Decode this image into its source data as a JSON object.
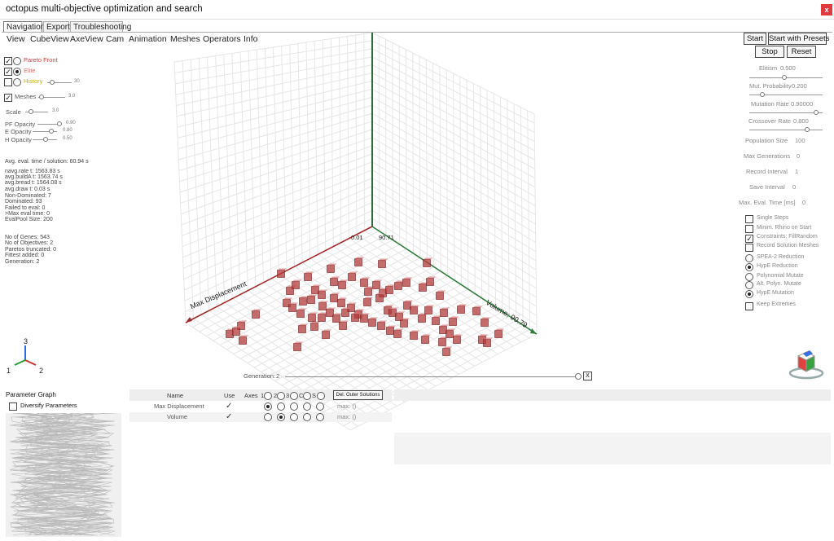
{
  "window": {
    "title": "octopus multi-objective optimization and search",
    "close_label": "x"
  },
  "tabs": [
    "Navigation",
    "Export",
    "Troubleshooting"
  ],
  "menu": [
    "View",
    "CubeView",
    "AxeView",
    "Cam",
    "Animation",
    "Meshes",
    "Operators",
    "Info"
  ],
  "left_panel": {
    "pareto_front": "Pareto Front",
    "elite": "Elite",
    "history": "History",
    "history_value": "30",
    "meshes": "Meshes",
    "meshes_value": "3.0",
    "scale": "Scale",
    "scale_value": "3.0",
    "pf_opacity": "PF Opacity",
    "pf_opacity_value": "0.90",
    "e_opacity": "E Opacity",
    "e_opacity_value": "0.80",
    "h_opacity": "H Opacity",
    "h_opacity_value": "0.50",
    "stats1": [
      "Avg. eval. time / solution: 60.94 s"
    ],
    "stats2": [
      "navg.rate t: 1563.83 s",
      "avg.buildA t: 1563.74 s",
      "avg.bread t: 1564.08 s",
      "avg.draw t: 0.03 s",
      "Non-Dominated: 7",
      "Dominated: 93",
      "Failed to eval: 0",
      ">Max eval time: 0",
      "EvalPool Size: 200"
    ],
    "stats3": [
      "No of Genes: 543",
      "No of Objectives: 2",
      "Paretos truncated: 0",
      "Fittest added: 0",
      "Generation: 2"
    ],
    "axis_labels": [
      "3",
      "1",
      "2"
    ]
  },
  "viewport": {
    "axis_x_label": "Max Displacement",
    "axis_y_label": "Volume: 90.79",
    "tick_a": "0.01",
    "tick_b": "90.71",
    "generation_label": "Generation:",
    "generation_value": "2",
    "generation_close": "X",
    "axis_colors": {
      "x": "#a42b2b",
      "y": "#2f7d3a",
      "z": "#2f6b3a"
    },
    "cube_color": "#b23b3b"
  },
  "right_panel": {
    "start": "Start",
    "start_presets": "Start with Presets",
    "stop": "Stop",
    "reset": "Reset",
    "elitism": "Elitism",
    "elitism_value": "0.500",
    "mut_prob": "Mut. Probability",
    "mut_prob_value": "0.200",
    "mut_rate": "Mutation Rate",
    "mut_rate_value": "0.90000",
    "cross_rate": "Crossover Rate",
    "cross_rate_value": "0.800",
    "pop_size": "Population Size",
    "pop_size_value": "100",
    "max_gen": "Max Generations",
    "max_gen_value": "0",
    "record_int": "Record Interval",
    "record_int_value": "1",
    "save_int": "Save Interval",
    "save_int_value": "0",
    "max_eval": "Max. Eval. Time [ms]",
    "max_eval_value": "0",
    "options": [
      {
        "label": "Single Steps",
        "kind": "check",
        "on": false
      },
      {
        "label": "Minim. Rhino on Start",
        "kind": "check",
        "on": false
      },
      {
        "label": "Constraints: FillRandom",
        "kind": "check",
        "on": true
      },
      {
        "label": "Record Solution Meshes",
        "kind": "check",
        "on": false
      },
      {
        "label": "SPEA-2 Reduction",
        "kind": "radio",
        "on": false
      },
      {
        "label": "HypE Reduction",
        "kind": "radio",
        "on": true
      },
      {
        "label": "Polynomial Mutate",
        "kind": "radio",
        "on": false
      },
      {
        "label": "Alt. Polyn. Mutate",
        "kind": "radio",
        "on": false
      },
      {
        "label": "HypE Mutation",
        "kind": "radio",
        "on": true
      },
      {
        "label": "Keep Extremes",
        "kind": "check",
        "on": false
      }
    ]
  },
  "bottom": {
    "param_graph": "Parameter Graph",
    "diversify": "Diversify Parameters",
    "table_headers": {
      "name": "Name",
      "use": "Use",
      "axes": "Axes",
      "a1": "1",
      "a2": "2",
      "a3": "3",
      "ac": "C",
      "as": "S"
    },
    "del_outer": "Del. Outer Solutions",
    "rows": [
      {
        "name": "Max Displacement",
        "use": "✓",
        "sel": 0,
        "max": "max: ()"
      },
      {
        "name": "Volume",
        "use": "✓",
        "sel": 1,
        "max": "max: ()"
      }
    ]
  }
}
